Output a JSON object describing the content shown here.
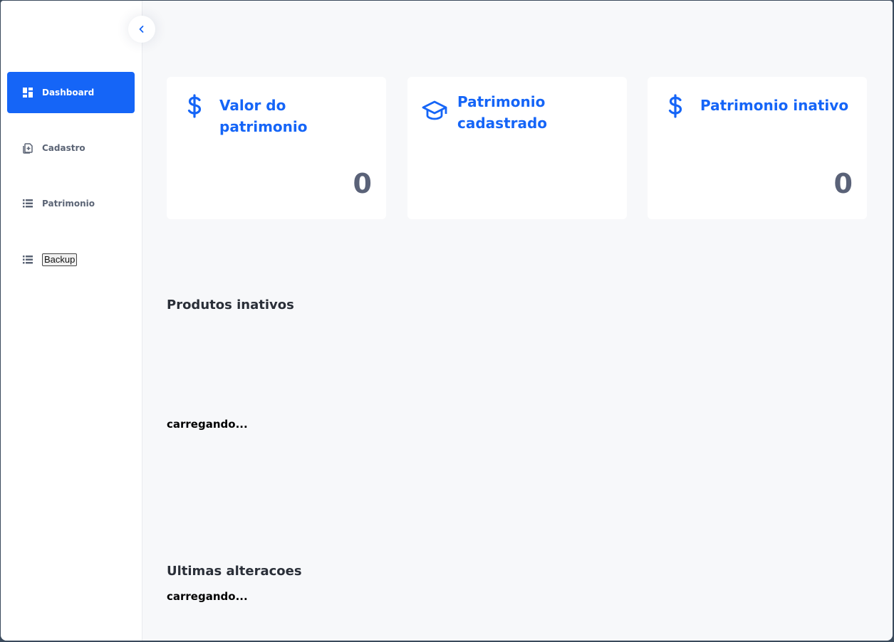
{
  "sidebar": {
    "items": [
      {
        "label": "Dashboard",
        "icon": "dashboard-icon",
        "active": true
      },
      {
        "label": "Cadastro",
        "icon": "document-add-icon",
        "active": false
      },
      {
        "label": "Patrimonio",
        "icon": "list-icon",
        "active": false
      },
      {
        "label": "Backup",
        "icon": "list-icon",
        "active": false
      }
    ]
  },
  "cards": [
    {
      "title": "Valor do patrimonio",
      "icon": "dollar-icon",
      "value": "0"
    },
    {
      "title": "Patrimonio cadastrado",
      "icon": "graduation-cap-icon",
      "value": ""
    },
    {
      "title": "Patrimonio inativo",
      "icon": "dollar-icon",
      "value": "0"
    }
  ],
  "sections": {
    "inactive_products": {
      "title": "Produtos inativos",
      "status": "carregando..."
    },
    "recent_changes": {
      "title": "Ultimas alteracoes",
      "status": "carregando..."
    }
  },
  "colors": {
    "accent": "#1565f7",
    "value_text": "#5a6278",
    "background": "#f7f8fa"
  }
}
